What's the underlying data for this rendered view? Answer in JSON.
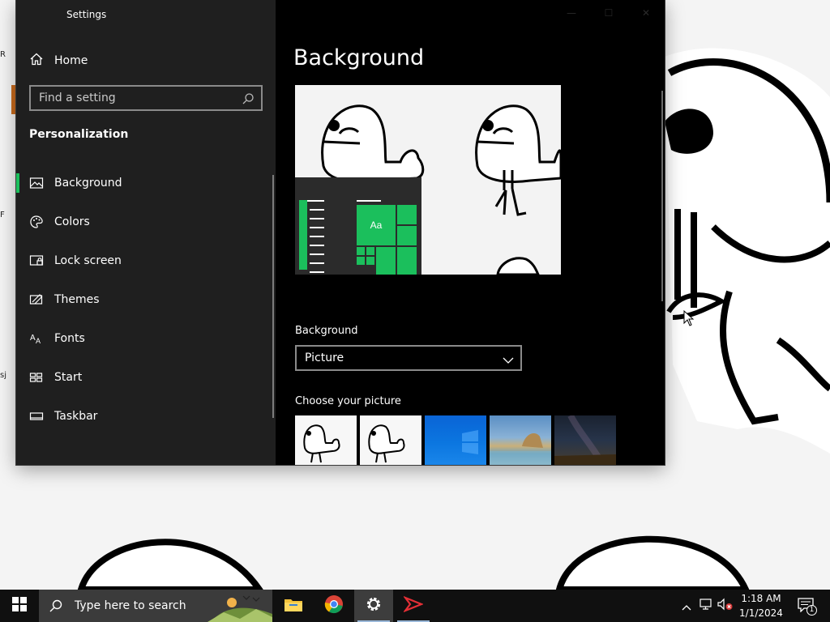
{
  "window": {
    "title": "Settings",
    "controls": {
      "minimize": "—",
      "maximize": "☐",
      "close": "✕"
    }
  },
  "sidebar": {
    "home_label": "Home",
    "search_placeholder": "Find a setting",
    "section_title": "Personalization",
    "items": [
      {
        "label": "Background",
        "icon": "picture-icon",
        "active": true
      },
      {
        "label": "Colors",
        "icon": "palette-icon",
        "active": false
      },
      {
        "label": "Lock screen",
        "icon": "lock-screen-icon",
        "active": false
      },
      {
        "label": "Themes",
        "icon": "themes-icon",
        "active": false
      },
      {
        "label": "Fonts",
        "icon": "fonts-icon",
        "active": false
      },
      {
        "label": "Start",
        "icon": "start-icon",
        "active": false
      },
      {
        "label": "Taskbar",
        "icon": "taskbar-icon",
        "active": false
      }
    ]
  },
  "main": {
    "page_title": "Background",
    "preview_sample_text": "Aa",
    "background_label": "Background",
    "background_value": "Picture",
    "choose_picture_label": "Choose your picture",
    "thumbnails": [
      "duck-drawing",
      "duck-drawing",
      "windows-blue",
      "beach-rocks",
      "night-sky"
    ]
  },
  "taskbar": {
    "search_text": "Type here to search",
    "apps": [
      "file-explorer",
      "chrome",
      "settings",
      "media-app"
    ],
    "clock_time": "1:18 AM",
    "clock_date": "1/1/2024",
    "notification_count": "1"
  },
  "colors": {
    "accent": "#1bbf5c",
    "sidebar_bg": "#1f1f1f",
    "main_bg": "#000000",
    "taskbar_bg": "#101010"
  }
}
